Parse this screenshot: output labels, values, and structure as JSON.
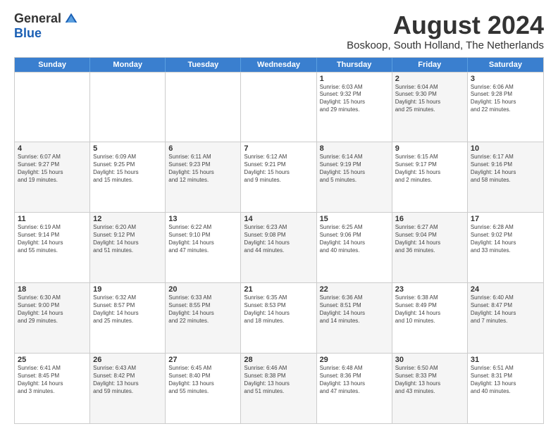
{
  "logo": {
    "general": "General",
    "blue": "Blue"
  },
  "title": "August 2024",
  "subtitle": "Boskoop, South Holland, The Netherlands",
  "days": [
    "Sunday",
    "Monday",
    "Tuesday",
    "Wednesday",
    "Thursday",
    "Friday",
    "Saturday"
  ],
  "weeks": [
    [
      {
        "day": "",
        "info": "",
        "shaded": false,
        "empty": true
      },
      {
        "day": "",
        "info": "",
        "shaded": false,
        "empty": true
      },
      {
        "day": "",
        "info": "",
        "shaded": false,
        "empty": true
      },
      {
        "day": "",
        "info": "",
        "shaded": false,
        "empty": true
      },
      {
        "day": "1",
        "info": "Sunrise: 6:03 AM\nSunset: 9:32 PM\nDaylight: 15 hours\nand 29 minutes.",
        "shaded": false,
        "empty": false
      },
      {
        "day": "2",
        "info": "Sunrise: 6:04 AM\nSunset: 9:30 PM\nDaylight: 15 hours\nand 25 minutes.",
        "shaded": true,
        "empty": false
      },
      {
        "day": "3",
        "info": "Sunrise: 6:06 AM\nSunset: 9:28 PM\nDaylight: 15 hours\nand 22 minutes.",
        "shaded": false,
        "empty": false
      }
    ],
    [
      {
        "day": "4",
        "info": "Sunrise: 6:07 AM\nSunset: 9:27 PM\nDaylight: 15 hours\nand 19 minutes.",
        "shaded": true,
        "empty": false
      },
      {
        "day": "5",
        "info": "Sunrise: 6:09 AM\nSunset: 9:25 PM\nDaylight: 15 hours\nand 15 minutes.",
        "shaded": false,
        "empty": false
      },
      {
        "day": "6",
        "info": "Sunrise: 6:11 AM\nSunset: 9:23 PM\nDaylight: 15 hours\nand 12 minutes.",
        "shaded": true,
        "empty": false
      },
      {
        "day": "7",
        "info": "Sunrise: 6:12 AM\nSunset: 9:21 PM\nDaylight: 15 hours\nand 9 minutes.",
        "shaded": false,
        "empty": false
      },
      {
        "day": "8",
        "info": "Sunrise: 6:14 AM\nSunset: 9:19 PM\nDaylight: 15 hours\nand 5 minutes.",
        "shaded": true,
        "empty": false
      },
      {
        "day": "9",
        "info": "Sunrise: 6:15 AM\nSunset: 9:17 PM\nDaylight: 15 hours\nand 2 minutes.",
        "shaded": false,
        "empty": false
      },
      {
        "day": "10",
        "info": "Sunrise: 6:17 AM\nSunset: 9:16 PM\nDaylight: 14 hours\nand 58 minutes.",
        "shaded": true,
        "empty": false
      }
    ],
    [
      {
        "day": "11",
        "info": "Sunrise: 6:19 AM\nSunset: 9:14 PM\nDaylight: 14 hours\nand 55 minutes.",
        "shaded": false,
        "empty": false
      },
      {
        "day": "12",
        "info": "Sunrise: 6:20 AM\nSunset: 9:12 PM\nDaylight: 14 hours\nand 51 minutes.",
        "shaded": true,
        "empty": false
      },
      {
        "day": "13",
        "info": "Sunrise: 6:22 AM\nSunset: 9:10 PM\nDaylight: 14 hours\nand 47 minutes.",
        "shaded": false,
        "empty": false
      },
      {
        "day": "14",
        "info": "Sunrise: 6:23 AM\nSunset: 9:08 PM\nDaylight: 14 hours\nand 44 minutes.",
        "shaded": true,
        "empty": false
      },
      {
        "day": "15",
        "info": "Sunrise: 6:25 AM\nSunset: 9:06 PM\nDaylight: 14 hours\nand 40 minutes.",
        "shaded": false,
        "empty": false
      },
      {
        "day": "16",
        "info": "Sunrise: 6:27 AM\nSunset: 9:04 PM\nDaylight: 14 hours\nand 36 minutes.",
        "shaded": true,
        "empty": false
      },
      {
        "day": "17",
        "info": "Sunrise: 6:28 AM\nSunset: 9:02 PM\nDaylight: 14 hours\nand 33 minutes.",
        "shaded": false,
        "empty": false
      }
    ],
    [
      {
        "day": "18",
        "info": "Sunrise: 6:30 AM\nSunset: 9:00 PM\nDaylight: 14 hours\nand 29 minutes.",
        "shaded": true,
        "empty": false
      },
      {
        "day": "19",
        "info": "Sunrise: 6:32 AM\nSunset: 8:57 PM\nDaylight: 14 hours\nand 25 minutes.",
        "shaded": false,
        "empty": false
      },
      {
        "day": "20",
        "info": "Sunrise: 6:33 AM\nSunset: 8:55 PM\nDaylight: 14 hours\nand 22 minutes.",
        "shaded": true,
        "empty": false
      },
      {
        "day": "21",
        "info": "Sunrise: 6:35 AM\nSunset: 8:53 PM\nDaylight: 14 hours\nand 18 minutes.",
        "shaded": false,
        "empty": false
      },
      {
        "day": "22",
        "info": "Sunrise: 6:36 AM\nSunset: 8:51 PM\nDaylight: 14 hours\nand 14 minutes.",
        "shaded": true,
        "empty": false
      },
      {
        "day": "23",
        "info": "Sunrise: 6:38 AM\nSunset: 8:49 PM\nDaylight: 14 hours\nand 10 minutes.",
        "shaded": false,
        "empty": false
      },
      {
        "day": "24",
        "info": "Sunrise: 6:40 AM\nSunset: 8:47 PM\nDaylight: 14 hours\nand 7 minutes.",
        "shaded": true,
        "empty": false
      }
    ],
    [
      {
        "day": "25",
        "info": "Sunrise: 6:41 AM\nSunset: 8:45 PM\nDaylight: 14 hours\nand 3 minutes.",
        "shaded": false,
        "empty": false
      },
      {
        "day": "26",
        "info": "Sunrise: 6:43 AM\nSunset: 8:42 PM\nDaylight: 13 hours\nand 59 minutes.",
        "shaded": true,
        "empty": false
      },
      {
        "day": "27",
        "info": "Sunrise: 6:45 AM\nSunset: 8:40 PM\nDaylight: 13 hours\nand 55 minutes.",
        "shaded": false,
        "empty": false
      },
      {
        "day": "28",
        "info": "Sunrise: 6:46 AM\nSunset: 8:38 PM\nDaylight: 13 hours\nand 51 minutes.",
        "shaded": true,
        "empty": false
      },
      {
        "day": "29",
        "info": "Sunrise: 6:48 AM\nSunset: 8:36 PM\nDaylight: 13 hours\nand 47 minutes.",
        "shaded": false,
        "empty": false
      },
      {
        "day": "30",
        "info": "Sunrise: 6:50 AM\nSunset: 8:33 PM\nDaylight: 13 hours\nand 43 minutes.",
        "shaded": true,
        "empty": false
      },
      {
        "day": "31",
        "info": "Sunrise: 6:51 AM\nSunset: 8:31 PM\nDaylight: 13 hours\nand 40 minutes.",
        "shaded": false,
        "empty": false
      }
    ]
  ]
}
